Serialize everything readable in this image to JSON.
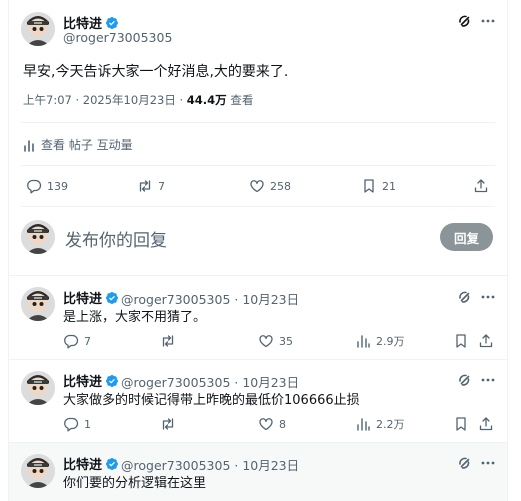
{
  "main_post": {
    "author_name": "比特进",
    "handle": "@roger73005305",
    "text": "早安,今天告诉大家一个好消息,大的要来了.",
    "time": "上午7:07 · 2025年10月23日 · ",
    "views_count": "44.4万",
    "views_label": " 查看",
    "analytics_label": "查看 帖子 互动量",
    "actions": {
      "replies": "139",
      "reposts": "7",
      "likes": "258",
      "bookmarks": "21"
    }
  },
  "composer": {
    "placeholder": "发布你的回复",
    "button_label": "回复"
  },
  "replies": [
    {
      "author_name": "比特进",
      "handle_date": "@roger73005305 · 10月23日",
      "text": "是上涨，大家不用猜了。",
      "replies": "7",
      "reposts": "",
      "likes": "35",
      "views": "2.9万"
    },
    {
      "author_name": "比特进",
      "handle_date": "@roger73005305 · 10月23日",
      "text": "大家做多的时候记得带上昨晚的最低价106666止损",
      "replies": "1",
      "reposts": "",
      "likes": "8",
      "views": "2.2万"
    },
    {
      "author_name": "比特进",
      "handle_date": "@roger73005305 · 10月23日",
      "text": "你们要的分析逻辑在这里"
    }
  ],
  "colors": {
    "verified": "#1d9bf0",
    "secondary": "#536471",
    "button": "#8b9599"
  },
  "icons": [
    "verified-badge-icon",
    "grok-icon",
    "more-icon",
    "analytics-icon",
    "reply-icon",
    "repost-icon",
    "like-icon",
    "views-icon",
    "bookmark-icon",
    "share-icon"
  ]
}
